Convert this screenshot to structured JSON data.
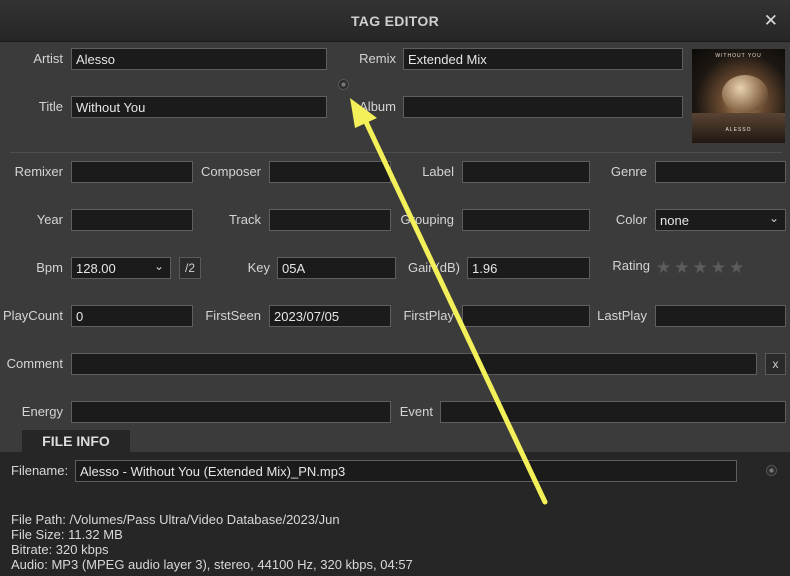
{
  "window": {
    "title": "TAG EDITOR",
    "close_glyph": "✕"
  },
  "top": {
    "artist_label": "Artist",
    "artist_value": "Alesso",
    "remix_label": "Remix",
    "remix_value": "Extended Mix",
    "title_label": "Title",
    "title_value": "Without You",
    "album_label": "Album",
    "album_value": "",
    "artwork_text": "WITHOUT YOU",
    "artwork_artist": "ALESSO"
  },
  "row1": {
    "remixer_label": "Remixer",
    "remixer_value": "",
    "composer_label": "Composer",
    "composer_value": "",
    "label_label": "Label",
    "label_value": "",
    "genre_label": "Genre",
    "genre_value": ""
  },
  "row2": {
    "year_label": "Year",
    "year_value": "",
    "track_label": "Track",
    "track_value": "",
    "grouping_label": "Grouping",
    "grouping_value": "",
    "color_label": "Color",
    "color_value": "none"
  },
  "row3": {
    "bpm_label": "Bpm",
    "bpm_value": "128.00",
    "half_label": "/2",
    "key_label": "Key",
    "key_value": "05A",
    "gain_label": "Gain(dB)",
    "gain_value": "1.96",
    "rating_label": "Rating",
    "rating_value": 0,
    "rating_max": 5
  },
  "row4": {
    "playcount_label": "PlayCount",
    "playcount_value": "0",
    "firstseen_label": "FirstSeen",
    "firstseen_value": "2023/07/05",
    "firstplay_label": "FirstPlay",
    "firstplay_value": "",
    "lastplay_label": "LastPlay",
    "lastplay_value": ""
  },
  "row5": {
    "comment_label": "Comment",
    "comment_value": "",
    "clear_label": "x"
  },
  "row6": {
    "energy_label": "Energy",
    "energy_value": "",
    "event_label": "Event",
    "event_value": ""
  },
  "fileinfo": {
    "tab_label": "FILE INFO",
    "filename_label": "Filename:",
    "filename_value": "Alesso - Without You (Extended Mix)_PN.mp3",
    "path_line": "File Path: /Volumes/Pass Ultra/Video Database/2023/Jun",
    "size_line": "File Size: 11.32 MB",
    "bitrate_line": "Bitrate: 320 kbps",
    "audio_line": "Audio: MP3 (MPEG audio layer 3), stereo, 44100 Hz, 320 kbps, 04:57"
  },
  "colors": {
    "annotation_arrow": "#f3f05a",
    "field_bg": "#1b1b1b",
    "panel_bg": "#3b3b3b"
  }
}
